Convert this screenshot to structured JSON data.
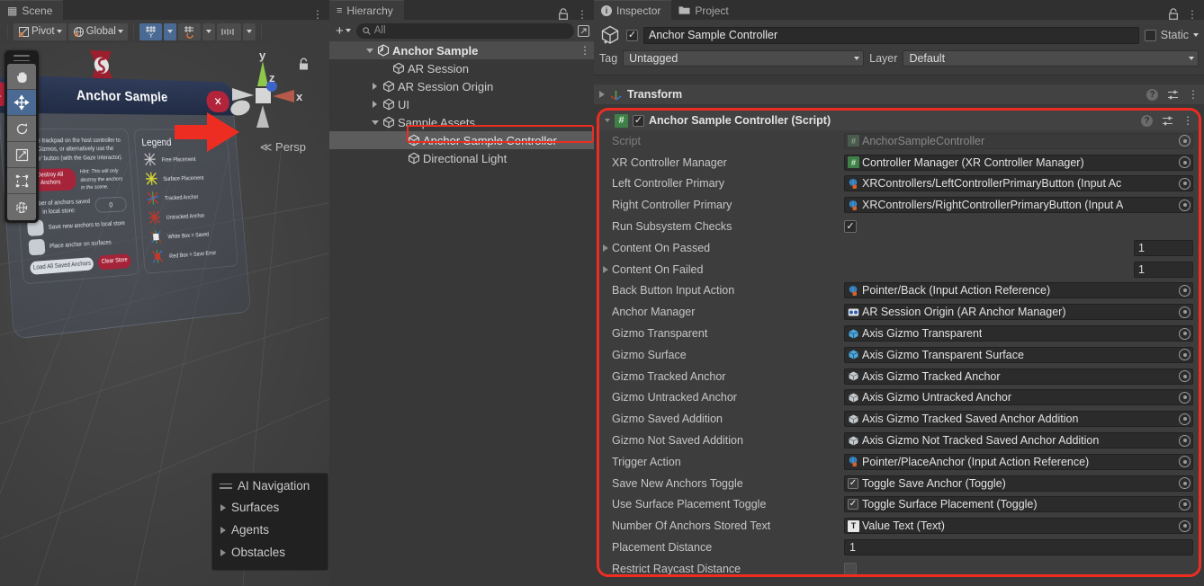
{
  "scene": {
    "tab_label": "Scene",
    "tab_icon": "grid-icon",
    "kebab": "⋮",
    "toolbar": {
      "pivot_label": "Pivot",
      "handle_label": "Global",
      "grid_icon": "grid-snap-icon",
      "snap_icon": "magnet-snap-icon",
      "ruler_icon": "ruler-icon"
    },
    "tools": [
      {
        "name": "hand-tool",
        "glyph": "✋",
        "selected": false
      },
      {
        "name": "move-tool",
        "glyph": "✥",
        "selected": true
      },
      {
        "name": "rotate-tool",
        "glyph": "⟳",
        "selected": false
      },
      {
        "name": "scale-tool",
        "glyph": "↗",
        "selected": false
      },
      {
        "name": "rect-tool",
        "glyph": "□",
        "selected": false
      },
      {
        "name": "transform-tool",
        "glyph": "⊕",
        "selected": false
      }
    ],
    "gizmo": {
      "x_label": "x",
      "y_label": "y",
      "z_label": "z",
      "persp_label": "Persp",
      "persp_prefix": "≪"
    },
    "ai_navigation": {
      "title": "AI Navigation",
      "rows": [
        "Surfaces",
        "Agents",
        "Obstacles"
      ]
    },
    "vr_panel": {
      "title": "Anchor Sample",
      "back_glyph": "←",
      "close_glyph": "✕",
      "instructions": "Tap the trackpad on the host controller to place Gizmos, or alternatively use the 'Create' button (with the Gaze Interactor).",
      "destroy_button": "Destroy All Anchors",
      "hint": "Hint: This will only destroy the anchors in the scene.",
      "stored_label": "Number of anchors saved in local store:",
      "stored_value": "0",
      "toggle1_label": "Save new anchors to local store",
      "toggle2_label": "Place anchor on surfaces",
      "load_button": "Load All Saved Anchors",
      "clear_button": "Clear Store",
      "legend_title": "Legend",
      "legend": [
        {
          "label": "Free Placement",
          "color": "#c9c9c9"
        },
        {
          "label": "Surface Placement",
          "color": "#d9d932"
        },
        {
          "label": "Tracked Anchor",
          "color": "#4a6fd8"
        },
        {
          "label": "Untracked Anchor",
          "color": "#c0392b"
        },
        {
          "label": "White Box = Saved",
          "color": "#e8e8e8"
        },
        {
          "label": "Red Box = Save Error",
          "color": "#c0392b"
        }
      ]
    }
  },
  "hierarchy": {
    "tab_label": "Hierarchy",
    "tab_icon": "list-icon",
    "lock_icon": "lock-icon",
    "kebab": "⋮",
    "add_label": "+",
    "search_placeholder": "All",
    "search_icon": "search-icon",
    "expand_icon": "expand-window-icon",
    "items": [
      {
        "label": "Anchor Sample",
        "depth": 0,
        "arrow": "down",
        "icon": "unity-logo-icon",
        "state": "root"
      },
      {
        "label": "AR Session",
        "depth": 1,
        "arrow": "none",
        "icon": "gameobject-icon",
        "state": "normal"
      },
      {
        "label": "AR Session Origin",
        "depth": 1,
        "arrow": "right",
        "icon": "gameobject-icon",
        "state": "normal"
      },
      {
        "label": "UI",
        "depth": 1,
        "arrow": "right",
        "icon": "gameobject-icon",
        "state": "normal"
      },
      {
        "label": "Sample Assets",
        "depth": 1,
        "arrow": "down",
        "icon": "gameobject-icon",
        "state": "normal"
      },
      {
        "label": "Anchor Sample Controller",
        "depth": 2,
        "arrow": "none",
        "icon": "gameobject-icon",
        "state": "selected"
      },
      {
        "label": "Directional Light",
        "depth": 2,
        "arrow": "none",
        "icon": "gameobject-icon",
        "state": "normal"
      }
    ]
  },
  "inspector": {
    "tabs": [
      {
        "label": "Inspector",
        "icon": "info-icon",
        "active": true
      },
      {
        "label": "Project",
        "icon": "folder-icon",
        "active": false
      }
    ],
    "lock_icon": "lock-icon",
    "kebab": "⋮",
    "object_icon": "gameobject-icon",
    "enabled_checked": true,
    "name_value": "Anchor Sample Controller",
    "static_label": "Static",
    "static_checked": false,
    "tag_label": "Tag",
    "tag_value": "Untagged",
    "layer_label": "Layer",
    "layer_value": "Default",
    "transform": {
      "title": "Transform",
      "icon": "transform-axis-icon",
      "help_icon": "help-icon",
      "preset_icon": "preset-icon",
      "kebab": "⋮"
    },
    "script_component": {
      "title": "Anchor Sample Controller (Script)",
      "icon": "cs-script-icon",
      "enabled_checked": true,
      "help_icon": "help-icon",
      "preset_icon": "preset-icon",
      "kebab": "⋮",
      "highlight_color": "#ee2d22",
      "properties": [
        {
          "label": "Script",
          "type": "object",
          "value": "AnchorSampleController",
          "icon": "cs-script-icon",
          "disabled": true
        },
        {
          "label": "XR Controller Manager",
          "type": "object",
          "value": "Controller Manager (XR Controller Manager)",
          "icon": "cs-script-icon"
        },
        {
          "label": "Left Controller Primary",
          "type": "object",
          "value": "XRControllers/LeftControllerPrimaryButton (Input Ac",
          "icon": "input-action-icon"
        },
        {
          "label": "Right Controller Primary",
          "type": "object",
          "value": "XRControllers/RightControllerPrimaryButton (Input A",
          "icon": "input-action-icon"
        },
        {
          "label": "Run Subsystem Checks",
          "type": "checkbox",
          "checked": true
        },
        {
          "label": "Content On Passed",
          "type": "number",
          "value": "1",
          "foldout": true
        },
        {
          "label": "Content On Failed",
          "type": "number",
          "value": "1",
          "foldout": true
        },
        {
          "label": "Back Button Input Action",
          "type": "object",
          "value": "Pointer/Back (Input Action Reference)",
          "icon": "input-action-icon"
        },
        {
          "label": "Anchor Manager",
          "type": "object",
          "value": "AR Session Origin (AR Anchor Manager)",
          "icon": "ar-manager-icon"
        },
        {
          "label": "Gizmo Transparent",
          "type": "object",
          "value": "Axis Gizmo Transparent",
          "icon": "prefab-icon"
        },
        {
          "label": "Gizmo Surface",
          "type": "object",
          "value": "Axis Gizmo Transparent Surface",
          "icon": "prefab-icon"
        },
        {
          "label": "Gizmo Tracked Anchor",
          "type": "object",
          "value": "Axis Gizmo Tracked Anchor",
          "icon": "prefab-icon"
        },
        {
          "label": "Gizmo Untracked Anchor",
          "type": "object",
          "value": "Axis Gizmo Untracked Anchor",
          "icon": "prefab-icon"
        },
        {
          "label": "Gizmo Saved Addition",
          "type": "object",
          "value": "Axis Gizmo Tracked Saved Anchor Addition",
          "icon": "prefab-icon"
        },
        {
          "label": "Gizmo Not Saved Addition",
          "type": "object",
          "value": "Axis Gizmo Not Tracked Saved Anchor Addition",
          "icon": "prefab-icon"
        },
        {
          "label": "Trigger Action",
          "type": "object",
          "value": "Pointer/PlaceAnchor (Input Action Reference)",
          "icon": "input-action-icon"
        },
        {
          "label": "Save New Anchors Toggle",
          "type": "object",
          "value": "Toggle Save Anchor (Toggle)",
          "icon": "toggle-icon"
        },
        {
          "label": "Use Surface Placement Toggle",
          "type": "object",
          "value": "Toggle Surface Placement (Toggle)",
          "icon": "toggle-icon"
        },
        {
          "label": "Number Of Anchors Stored Text",
          "type": "object",
          "value": "Value Text (Text)",
          "icon": "text-icon"
        },
        {
          "label": "Placement Distance",
          "type": "text",
          "value": "1"
        },
        {
          "label": "Restrict Raycast Distance",
          "type": "checkbox",
          "checked": false
        }
      ]
    }
  },
  "annotation": {
    "arrow_color": "#ee2d22",
    "arrow_name": "red-pointer-arrow",
    "target": "Anchor Sample Controller"
  }
}
